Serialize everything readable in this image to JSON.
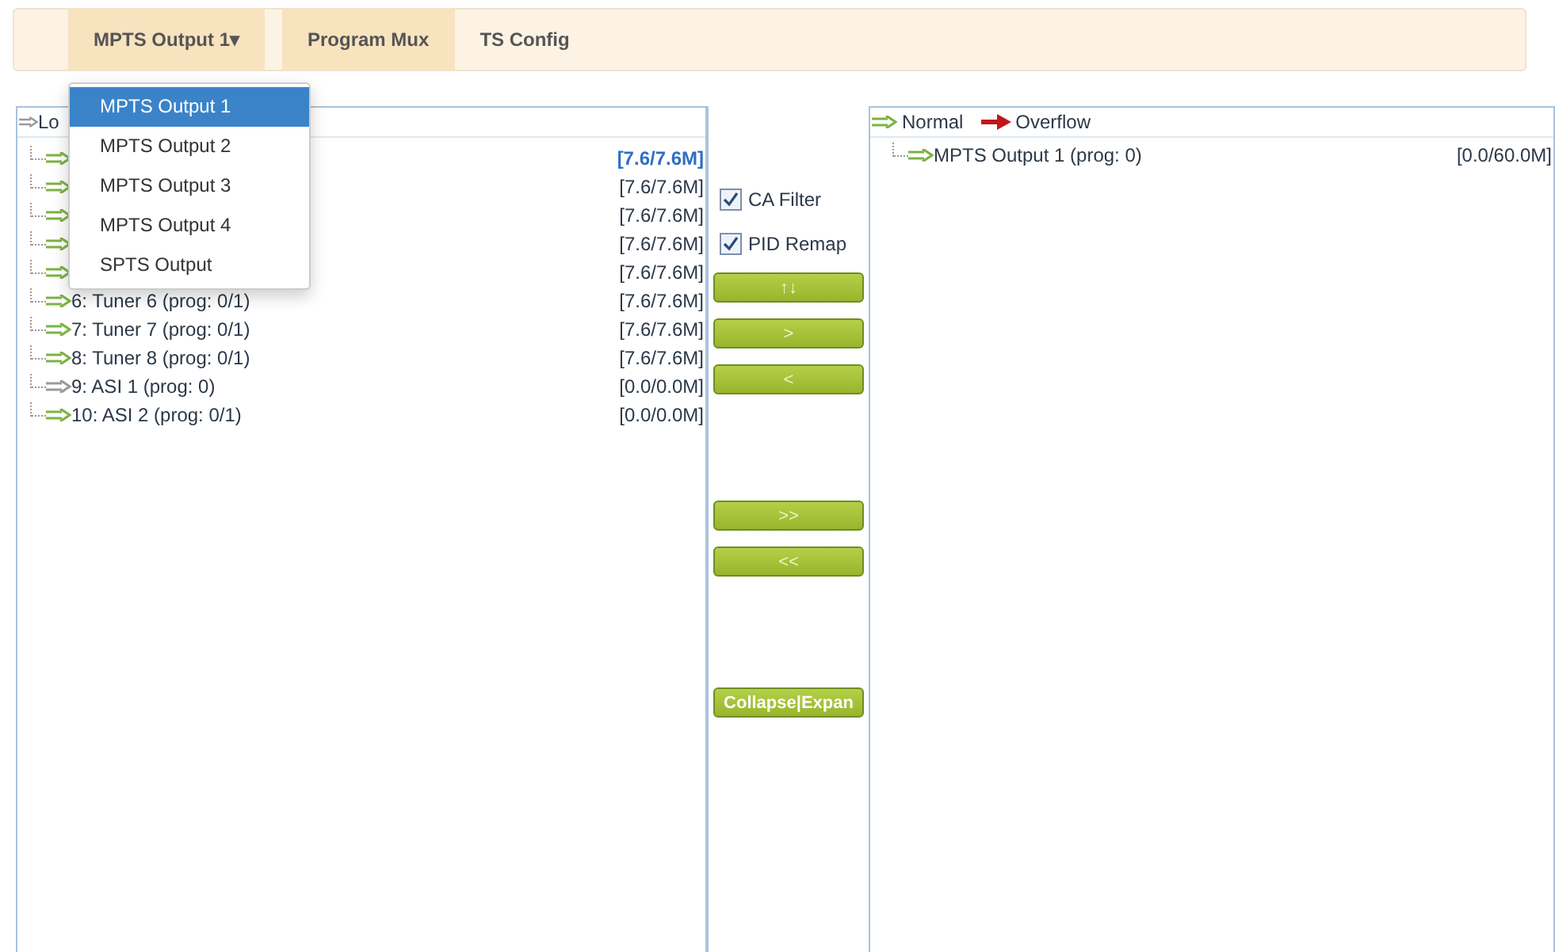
{
  "tabs": [
    {
      "label": "MPTS Output 1",
      "kind": "dropdown",
      "caret": "▾",
      "open": true
    },
    {
      "label": "Program Mux",
      "kind": "link",
      "selected": true
    },
    {
      "label": "TS Config",
      "kind": "link",
      "selected": false
    }
  ],
  "dropdown": {
    "items": [
      {
        "label": "MPTS Output 1",
        "selected": true
      },
      {
        "label": "MPTS Output 2",
        "selected": false
      },
      {
        "label": "MPTS Output 3",
        "selected": false
      },
      {
        "label": "MPTS Output 4",
        "selected": false
      },
      {
        "label": "SPTS Output",
        "selected": false
      }
    ]
  },
  "left_panel": {
    "header": "Lo",
    "rows": [
      {
        "rate": "[7.6/7.6M]",
        "active": true,
        "selected": true
      },
      {
        "rate": "[7.6/7.6M]",
        "active": true,
        "selected": false
      },
      {
        "rate": "[7.6/7.6M]",
        "active": true,
        "selected": false
      },
      {
        "rate": "[7.6/7.6M]",
        "active": true,
        "selected": false
      },
      {
        "rate": "[7.6/7.6M]",
        "active": true,
        "selected": false
      },
      {
        "label": "6: Tuner 6 (prog: 0/1)",
        "rate": "[7.6/7.6M]",
        "active": true,
        "selected": false
      },
      {
        "label": "7: Tuner 7 (prog: 0/1)",
        "rate": "[7.6/7.6M]",
        "active": true,
        "selected": false
      },
      {
        "label": "8: Tuner 8 (prog: 0/1)",
        "rate": "[7.6/7.6M]",
        "active": true,
        "selected": false
      },
      {
        "label": "9: ASI 1 (prog: 0)",
        "rate": "[0.0/0.0M]",
        "active": false,
        "selected": false
      },
      {
        "label": "10: ASI 2 (prog: 0/1)",
        "rate": "[0.0/0.0M]",
        "active": true,
        "selected": false
      }
    ]
  },
  "options": [
    {
      "label": "CA Filter",
      "checked": true
    },
    {
      "label": "PID Remap",
      "checked": true
    }
  ],
  "button_groups": [
    {
      "buttons": [
        "↑↓",
        ">",
        "<"
      ]
    },
    {
      "buttons": [
        ">>",
        "<<"
      ]
    },
    {
      "buttons": [
        "Collapse|Expan"
      ]
    }
  ],
  "right_panel": {
    "legend": [
      {
        "label": "Normal",
        "kind": "normal"
      },
      {
        "label": "Overflow",
        "kind": "overflow"
      }
    ],
    "rows": [
      {
        "label": "MPTS Output 1 (prog: 0)",
        "rate": "[0.0/60.0M]",
        "active": true
      }
    ]
  }
}
